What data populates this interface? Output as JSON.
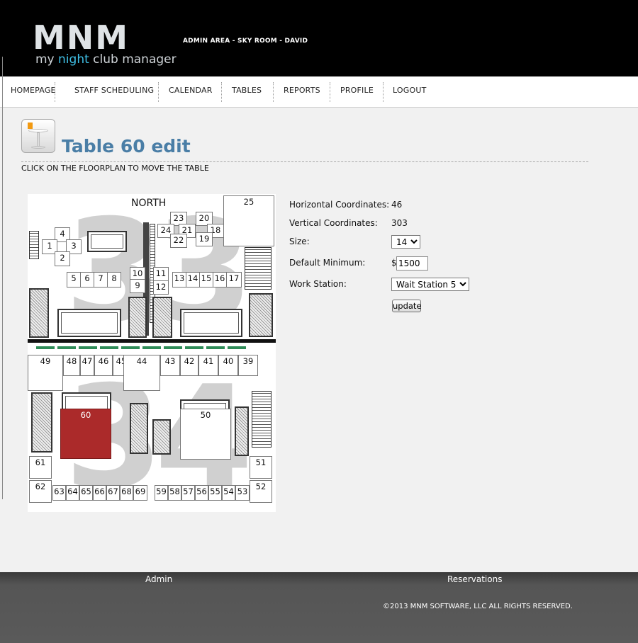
{
  "header": {
    "logo_text": "MNM",
    "logo_tagline_pre": "my ",
    "logo_tagline_hl": "night",
    "logo_tagline_post": " club manager",
    "admin_area": "ADMIN AREA - SKY ROOM - DAVID"
  },
  "nav": {
    "items": [
      "HOMEPAGE",
      "STAFF SCHEDULING",
      "CALENDAR",
      "TABLES",
      "REPORTS",
      "PROFILE",
      "LOGOUT"
    ]
  },
  "page": {
    "title": "Table 60 edit",
    "instruction": "CLICK ON THE FLOORPLAN TO MOVE THE TABLE"
  },
  "floorplan": {
    "north_label": "NORTH",
    "section_top_number": "33",
    "section_bottom_number": "34",
    "tables": [
      "25",
      "23",
      "20",
      "24",
      "21",
      "18",
      "22",
      "19",
      "4",
      "1",
      "3",
      "2",
      "10",
      "11",
      "9",
      "12",
      "5",
      "6",
      "7",
      "8",
      "13",
      "14",
      "15",
      "16",
      "17",
      "49",
      "48",
      "47",
      "46",
      "45",
      "44",
      "43",
      "42",
      "41",
      "40",
      "39",
      "60",
      "50",
      "61",
      "51",
      "62",
      "52",
      "63",
      "64",
      "65",
      "66",
      "67",
      "68",
      "69",
      "59",
      "58",
      "57",
      "56",
      "55",
      "54",
      "53"
    ],
    "selected_table": "60"
  },
  "form": {
    "horizontal_label": "Horizontal Coordinates:",
    "horizontal_value": "46",
    "vertical_label": "Vertical Coordinates:",
    "vertical_value": "303",
    "size_label": "Size:",
    "size_value": "14",
    "default_min_label": "Default Minimum:",
    "currency_symbol": "$",
    "default_min_value": "1500",
    "work_station_label": "Work Station:",
    "work_station_value": "Wait Station 5",
    "update_label": "update"
  },
  "footer": {
    "admin_link": "Admin",
    "reservations_link": "Reservations",
    "copyright": "©2013 MNM SOFTWARE, LLC ALL RIGHTS RESERVED."
  },
  "colors": {
    "selected_table": "#ab2a2a",
    "title": "#4a7ea6",
    "logo_accent": "#3fc0e6"
  }
}
